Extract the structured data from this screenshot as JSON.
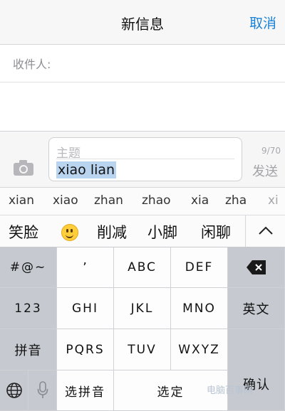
{
  "nav": {
    "title": "新信息",
    "cancel": "取消"
  },
  "recipient": {
    "label": "收件人:"
  },
  "compose": {
    "subject_placeholder": "主题",
    "message_text": "xiao lian",
    "char_count": "9/70",
    "send": "发送"
  },
  "pinyin_candidates": [
    "xian",
    "xiao",
    "zhan",
    "zhao",
    "xia",
    "zha",
    "xi"
  ],
  "word_candidates": {
    "first": "笑脸",
    "rest": [
      "削减",
      "小脚",
      "闲聊"
    ]
  },
  "keyboard": {
    "rows": [
      [
        "#@~",
        "’",
        "ABC",
        "DEF",
        ""
      ],
      [
        "123",
        "GHI",
        "JKL",
        "MNO",
        "英文"
      ],
      [
        "拼音",
        "PQRS",
        "TUV",
        "WXYZ"
      ],
      [
        "",
        "",
        "选拼音",
        "选定"
      ]
    ],
    "confirm": "确认"
  },
  "icons": {
    "camera": "camera-icon",
    "emoji": "smiley-emoji-icon",
    "collapse": "chevron-up-icon",
    "backspace": "backspace-icon",
    "globe": "globe-icon",
    "mic": "microphone-icon"
  },
  "colors": {
    "accent": "#1a82d6",
    "selection": "#b9d4ef"
  },
  "watermark": "电脑百事网"
}
